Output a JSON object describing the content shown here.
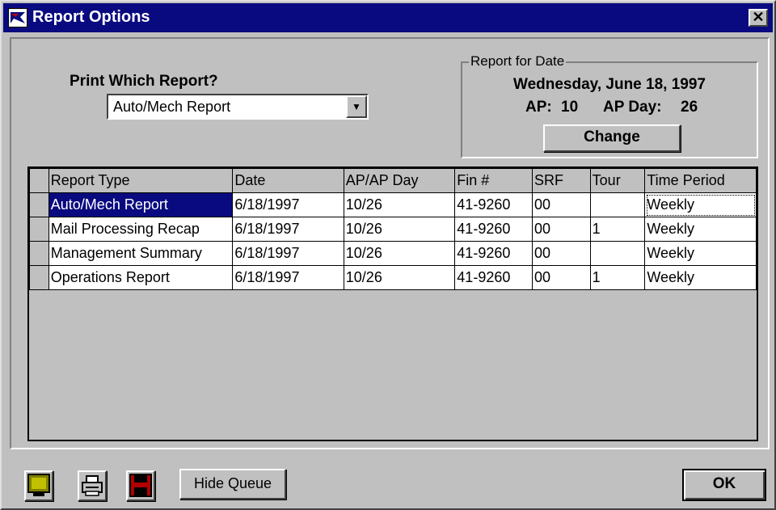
{
  "window": {
    "title": "Report Options",
    "close_glyph": "✕"
  },
  "print": {
    "label": "Print Which Report?",
    "selected": "Auto/Mech Report"
  },
  "report_date": {
    "group_label": "Report for Date",
    "date_text": "Wednesday, June 18, 1997",
    "ap_label": "AP:",
    "ap_value": "10",
    "ap_day_label": "AP Day:",
    "ap_day_value": "26",
    "change_label": "Change"
  },
  "grid": {
    "columns": [
      "Report Type",
      "Date",
      "AP/AP Day",
      "Fin #",
      "SRF",
      "Tour",
      "Time Period"
    ],
    "rows": [
      [
        "Auto/Mech Report",
        "6/18/1997",
        "10/26",
        "41-9260",
        "00",
        "",
        "Weekly"
      ],
      [
        "Mail Processing Recap",
        "6/18/1997",
        "10/26",
        "41-9260",
        "00",
        "1",
        "Weekly"
      ],
      [
        "Management Summary",
        "6/18/1997",
        "10/26",
        "41-9260",
        "00",
        "",
        "Weekly"
      ],
      [
        "Operations Report",
        "6/18/1997",
        "10/26",
        "41-9260",
        "00",
        "1",
        "Weekly"
      ]
    ]
  },
  "footer": {
    "hide_queue_label": "Hide Queue",
    "ok_label": "OK"
  },
  "icons": {
    "app": "eagle-icon",
    "preview": "monitor-icon",
    "print": "printer-icon",
    "save": "floppy-disk-icon"
  },
  "colors": {
    "titlebar": "#0a0a80",
    "face": "#c0c0c0",
    "selection": "#0a0a80"
  }
}
